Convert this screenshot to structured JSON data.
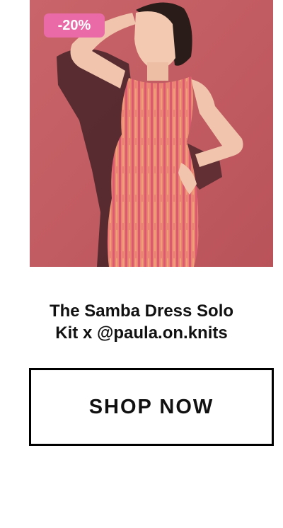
{
  "product": {
    "image_alt": "Woman wearing a pink and orange ribbed knit sleeveless dress against a red wall",
    "badge": "-20%",
    "title_line1": "The Samba Dress Solo",
    "title_line2": "Kit x @paula.on.knits",
    "cta_label": "SHOP NOW"
  },
  "colors": {
    "background": "#ffffff",
    "wall": "#c25a5f",
    "badge": "#e96aa7",
    "dress": "#e8786f",
    "button_border": "#000000"
  }
}
